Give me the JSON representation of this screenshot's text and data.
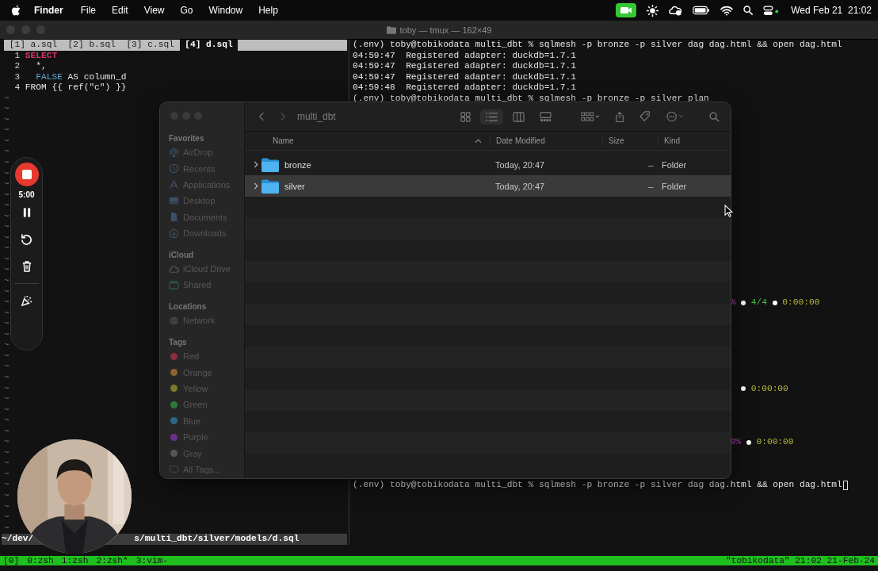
{
  "menu_bar": {
    "app_name": "Finder",
    "menus": [
      "File",
      "Edit",
      "View",
      "Go",
      "Window",
      "Help"
    ],
    "clock": "Wed Feb 21  21:02"
  },
  "terminal": {
    "title": "toby — tmux — 162×49",
    "editor": {
      "tabs": [
        {
          "label": "[1] a.sql",
          "selected": false
        },
        {
          "label": "[2] b.sql",
          "selected": false
        },
        {
          "label": "[3] c.sql",
          "selected": false
        },
        {
          "label": "[4] d.sql",
          "selected": true
        }
      ],
      "code_lines": [
        {
          "number": "1",
          "tokens": [
            {
              "kind": "keyword",
              "text": "SELECT"
            }
          ]
        },
        {
          "number": "2",
          "tokens": [
            {
              "kind": "plain",
              "text": "  *,"
            }
          ]
        },
        {
          "number": "3",
          "tokens": [
            {
              "kind": "constant",
              "text": "  FALSE"
            },
            {
              "kind": "plain",
              "text": " AS column_d"
            }
          ]
        },
        {
          "number": "4",
          "tokens": [
            {
              "kind": "plain",
              "text": "FROM {{ ref(\"c\") }}"
            }
          ]
        }
      ],
      "empty_lines": [
        "~",
        "~",
        "~",
        "~",
        "~",
        "~",
        "~",
        "~",
        "~",
        "~",
        "~",
        "~",
        "~",
        "~",
        "~",
        "~",
        "~",
        "~",
        "~",
        "~",
        "~",
        "~",
        "~",
        "~",
        "~",
        "~",
        "~",
        "~",
        "~",
        "~",
        "~",
        "~",
        "~",
        "~",
        "~",
        "~",
        "~",
        "~",
        "~",
        "~",
        "~"
      ],
      "file_path_parts": [
        "~/dev/",
        "s/multi_dbt/silver/models/d.sql"
      ]
    },
    "shell": {
      "lines": [
        "(.env) toby@tobikodata multi_dbt % sqlmesh -p bronze -p silver dag dag.html && open dag.html",
        "04:59:47  Registered adapter: duckdb=1.7.1",
        "04:59:47  Registered adapter: duckdb=1.7.1",
        "04:59:47  Registered adapter: duckdb=1.7.1",
        "04:59:48  Registered adapter: duckdb=1.7.1",
        "(.env) toby@tobikodata multi_dbt % sqlmesh -p bronze -p silver plan"
      ],
      "progress": [
        {
          "percent": "%",
          "count": "4/4",
          "elapsed": "0:00:00"
        },
        {
          "elapsed": "0:00:00"
        },
        {
          "percent": "0%",
          "elapsed": "0:00:00"
        }
      ],
      "prompt": "(.env) toby@tobikodata multi_dbt % sqlmesh -p bronze -p silver dag dag.html && open dag.html"
    },
    "status_bar": {
      "session": "[0]",
      "windows": [
        "0:zsh",
        "1:zsh",
        "2:zsh*",
        "3:vim-"
      ],
      "right": "\"tobikodata\" 21:02 21-Feb-24"
    }
  },
  "finder": {
    "title": "multi_dbt",
    "sidebar": [
      {
        "heading": "Favorites",
        "items": [
          {
            "label": "AirDrop",
            "kind": "place"
          },
          {
            "label": "Recents",
            "kind": "place"
          },
          {
            "label": "Applications",
            "kind": "place"
          },
          {
            "label": "Desktop",
            "kind": "place"
          },
          {
            "label": "Documents",
            "kind": "place"
          },
          {
            "label": "Downloads",
            "kind": "place"
          }
        ]
      },
      {
        "heading": "iCloud",
        "items": [
          {
            "label": "iCloud Drive",
            "kind": "place"
          },
          {
            "label": "Shared",
            "kind": "place"
          }
        ]
      },
      {
        "heading": "Locations",
        "items": [
          {
            "label": "Network",
            "kind": "place"
          }
        ]
      },
      {
        "heading": "Tags",
        "items": [
          {
            "label": "Red",
            "kind": "tag",
            "color": "#8c2c3c"
          },
          {
            "label": "Orange",
            "kind": "tag",
            "color": "#8a6230"
          },
          {
            "label": "Yellow",
            "kind": "tag",
            "color": "#7c7a2a"
          },
          {
            "label": "Green",
            "kind": "tag",
            "color": "#2c7a3c"
          },
          {
            "label": "Blue",
            "kind": "tag",
            "color": "#2c6688"
          },
          {
            "label": "Purple",
            "kind": "tag",
            "color": "#6a3088"
          },
          {
            "label": "Gray",
            "kind": "tag",
            "color": "#555555"
          },
          {
            "label": "All Tags...",
            "kind": "place"
          }
        ]
      }
    ],
    "columns": [
      "Name",
      "Date Modified",
      "Size",
      "Kind"
    ],
    "rows": [
      {
        "name": "bronze",
        "date": "Today, 20:47",
        "size": "--",
        "kind": "Folder",
        "selected": false
      },
      {
        "name": "silver",
        "date": "Today, 20:47",
        "size": "--",
        "kind": "Folder",
        "selected": true
      }
    ]
  },
  "recorder": {
    "timer": "5:00"
  }
}
